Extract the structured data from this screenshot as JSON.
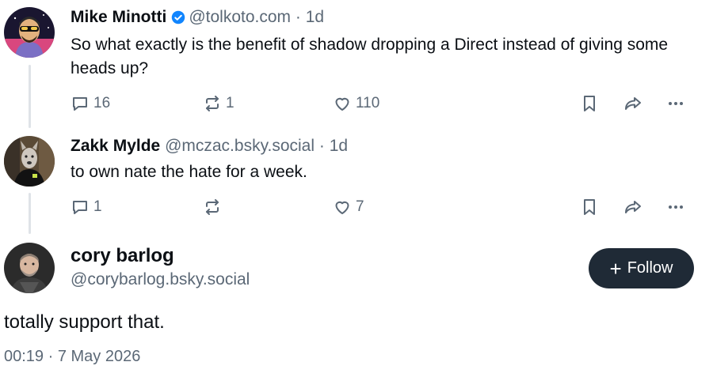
{
  "posts": [
    {
      "author": "Mike Minotti",
      "handle": "@tolkoto.com",
      "separator": "·",
      "time": "1d",
      "text": "So what exactly is the benefit of shadow dropping a Direct instead of giving some heads up?",
      "replies": "16",
      "reposts": "1",
      "likes": "110"
    },
    {
      "author": "Zakk Mylde",
      "handle": "@mczac.bsky.social",
      "separator": "·",
      "time": "1d",
      "text": "to own nate the hate for a week.",
      "replies": "1",
      "reposts": "",
      "likes": "7"
    }
  ],
  "main_post": {
    "author": "cory barlog",
    "handle": "@corybarlog.bsky.social",
    "follow_label": "Follow",
    "follow_icon": "+",
    "text": "totally support that.",
    "timestamp": "00:19 · 7 May 2026"
  },
  "colors": {
    "text": "#0b0f14",
    "muted": "#5b6876",
    "verified": "#1185fe",
    "follow_bg": "#1f2a36",
    "thread_line": "#dfe3e8"
  },
  "icons": [
    "reply-icon",
    "repost-icon",
    "like-icon",
    "bookmark-icon",
    "share-icon",
    "more-icon",
    "verified-icon"
  ]
}
